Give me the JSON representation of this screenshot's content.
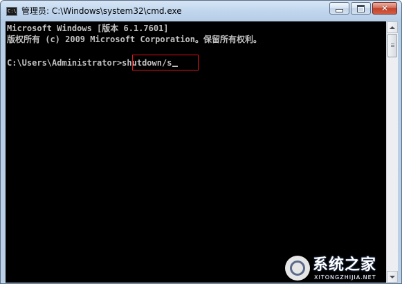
{
  "window": {
    "title": "管理员: C:\\Windows\\system32\\cmd.exe",
    "icon": "cmd-icon",
    "icon_glyph": "C:\\",
    "controls": {
      "minimize_icon": "minimize-icon",
      "maximize_icon": "maximize-icon",
      "close_icon": "close-icon",
      "close_glyph": "✕"
    }
  },
  "console": {
    "lines": [
      "Microsoft Windows [版本 6.1.7601]",
      "版权所有 (c) 2009 Microsoft Corporation。保留所有权利。",
      ""
    ],
    "prompt": "C:\\Users\\Administrator>",
    "command": "shutdown/s",
    "text_color": "#c0c0c0",
    "background": "#000000",
    "highlight_color": "#e0141e"
  },
  "scrollbar": {
    "up_icon": "arrow-up-icon",
    "down_icon": "arrow-down-icon"
  },
  "watermark": {
    "text": "系统之家",
    "subtext": "XITONGZHIJIA.NET"
  }
}
